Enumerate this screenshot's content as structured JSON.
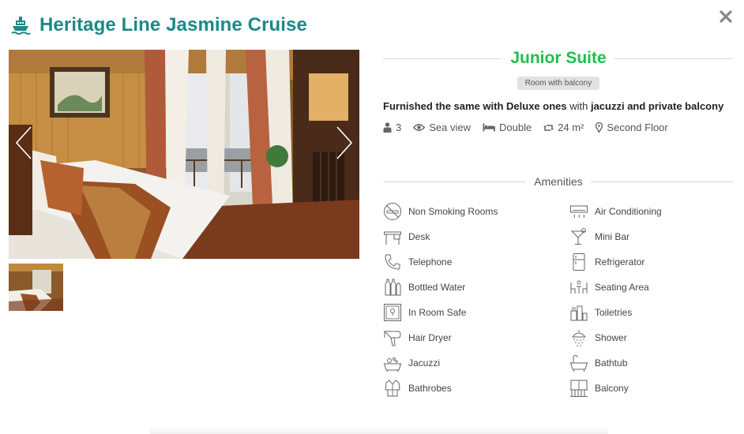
{
  "header": {
    "title": "Heritage Line Jasmine Cruise",
    "icon": "ship-icon"
  },
  "close": {
    "icon": "close-icon"
  },
  "gallery": {
    "prev_icon": "chevron-left-icon",
    "next_icon": "chevron-right-icon"
  },
  "room": {
    "name": "Junior Suite",
    "badge": "Room with balcony",
    "desc_part1": "Furnished the same with Deluxe ones",
    "desc_part2": " with ",
    "desc_part3": "jacuzzi and private balcony",
    "facts": [
      {
        "icon": "person-icon",
        "label": "3"
      },
      {
        "icon": "eye-icon",
        "label": "Sea view"
      },
      {
        "icon": "bed-icon",
        "label": "Double"
      },
      {
        "icon": "resize-icon",
        "label": "24 m²"
      },
      {
        "icon": "map-marker-icon",
        "label": "Second Floor"
      }
    ]
  },
  "amenities": {
    "title": "Amenities",
    "items": [
      {
        "label": "Non Smoking Rooms",
        "icon": "no-smoking-icon"
      },
      {
        "label": "Air Conditioning",
        "icon": "air-conditioner-icon"
      },
      {
        "label": "Desk",
        "icon": "desk-icon"
      },
      {
        "label": "Mini Bar",
        "icon": "cocktail-icon"
      },
      {
        "label": "Telephone",
        "icon": "telephone-icon"
      },
      {
        "label": "Refrigerator",
        "icon": "refrigerator-icon"
      },
      {
        "label": "Bottled Water",
        "icon": "water-bottle-icon"
      },
      {
        "label": "Seating Area",
        "icon": "seating-icon"
      },
      {
        "label": "In Room Safe",
        "icon": "safe-icon"
      },
      {
        "label": "Toiletries",
        "icon": "toiletries-icon"
      },
      {
        "label": "Hair Dryer",
        "icon": "hair-dryer-icon"
      },
      {
        "label": "Shower",
        "icon": "shower-icon"
      },
      {
        "label": "Jacuzzi",
        "icon": "jacuzzi-icon"
      },
      {
        "label": "Bathtub",
        "icon": "bathtub-icon"
      },
      {
        "label": "Bathrobes",
        "icon": "bathrobe-icon"
      },
      {
        "label": "Balcony",
        "icon": "balcony-icon"
      }
    ]
  },
  "colors": {
    "brand": "#1a8a87",
    "accent": "#1fbf4a",
    "badge_bg": "#e2e2e2"
  }
}
